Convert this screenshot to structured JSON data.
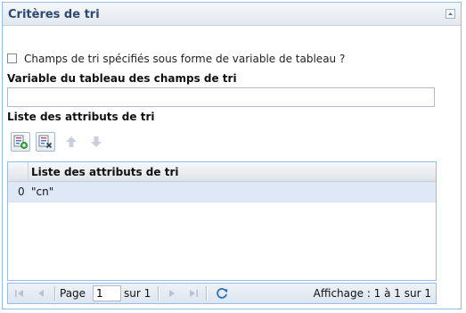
{
  "panel": {
    "title": "Critères de tri"
  },
  "checkbox": {
    "label": "Champs de tri spécifiés sous forme de variable de tableau ?",
    "checked": false
  },
  "variable_field": {
    "label": "Variable du tableau des champs de tri",
    "value": ""
  },
  "list_section": {
    "label": "Liste des attributs de tri"
  },
  "toolbar": {
    "icons": [
      "add-attribute-icon",
      "remove-attribute-icon",
      "move-up-icon",
      "move-down-icon"
    ]
  },
  "grid": {
    "column_header": "Liste des attributs de tri",
    "rows": [
      {
        "index": "0",
        "value": "\"cn\""
      }
    ]
  },
  "pager": {
    "page_label": "Page",
    "current_page": "1",
    "of_label": "sur 1",
    "display_text": "Affichage : 1 à 1 sur 1"
  },
  "colors": {
    "border": "#99bbe8",
    "selected_row": "#dfe8f6",
    "title": "#2b4a73"
  }
}
